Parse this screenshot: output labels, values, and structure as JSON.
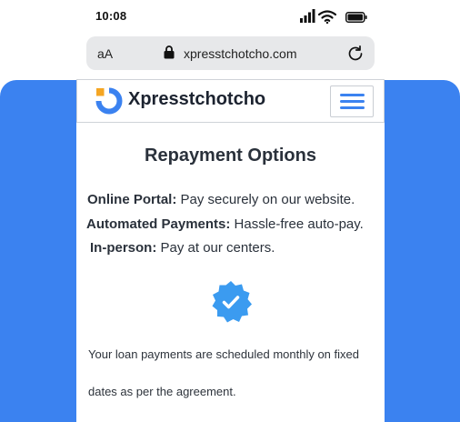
{
  "status_bar": {
    "time": "10:08"
  },
  "url_bar": {
    "text_size_label": "aA",
    "url": "xpresstchotcho.com"
  },
  "site": {
    "brand": "Xpresstchotcho"
  },
  "content": {
    "title": "Repayment Options",
    "options": [
      {
        "label": "Online Portal:",
        "text": " Pay securely on our website."
      },
      {
        "label": "Automated Payments:",
        "text": " Hassle-free auto-pay."
      },
      {
        "label": "In-person:",
        "text": " Pay at our centers."
      }
    ],
    "paragraph": "Your loan payments are scheduled monthly on fixed dates as per the agreement."
  },
  "colors": {
    "accent_blue": "#3b82f0",
    "logo_orange": "#f5a623",
    "badge_blue": "#3b9bf0"
  },
  "icons": [
    "signal-icon",
    "wifi-icon",
    "battery-icon",
    "lock-icon",
    "reload-icon",
    "logo-icon",
    "hamburger-menu-icon",
    "verified-badge-icon"
  ]
}
